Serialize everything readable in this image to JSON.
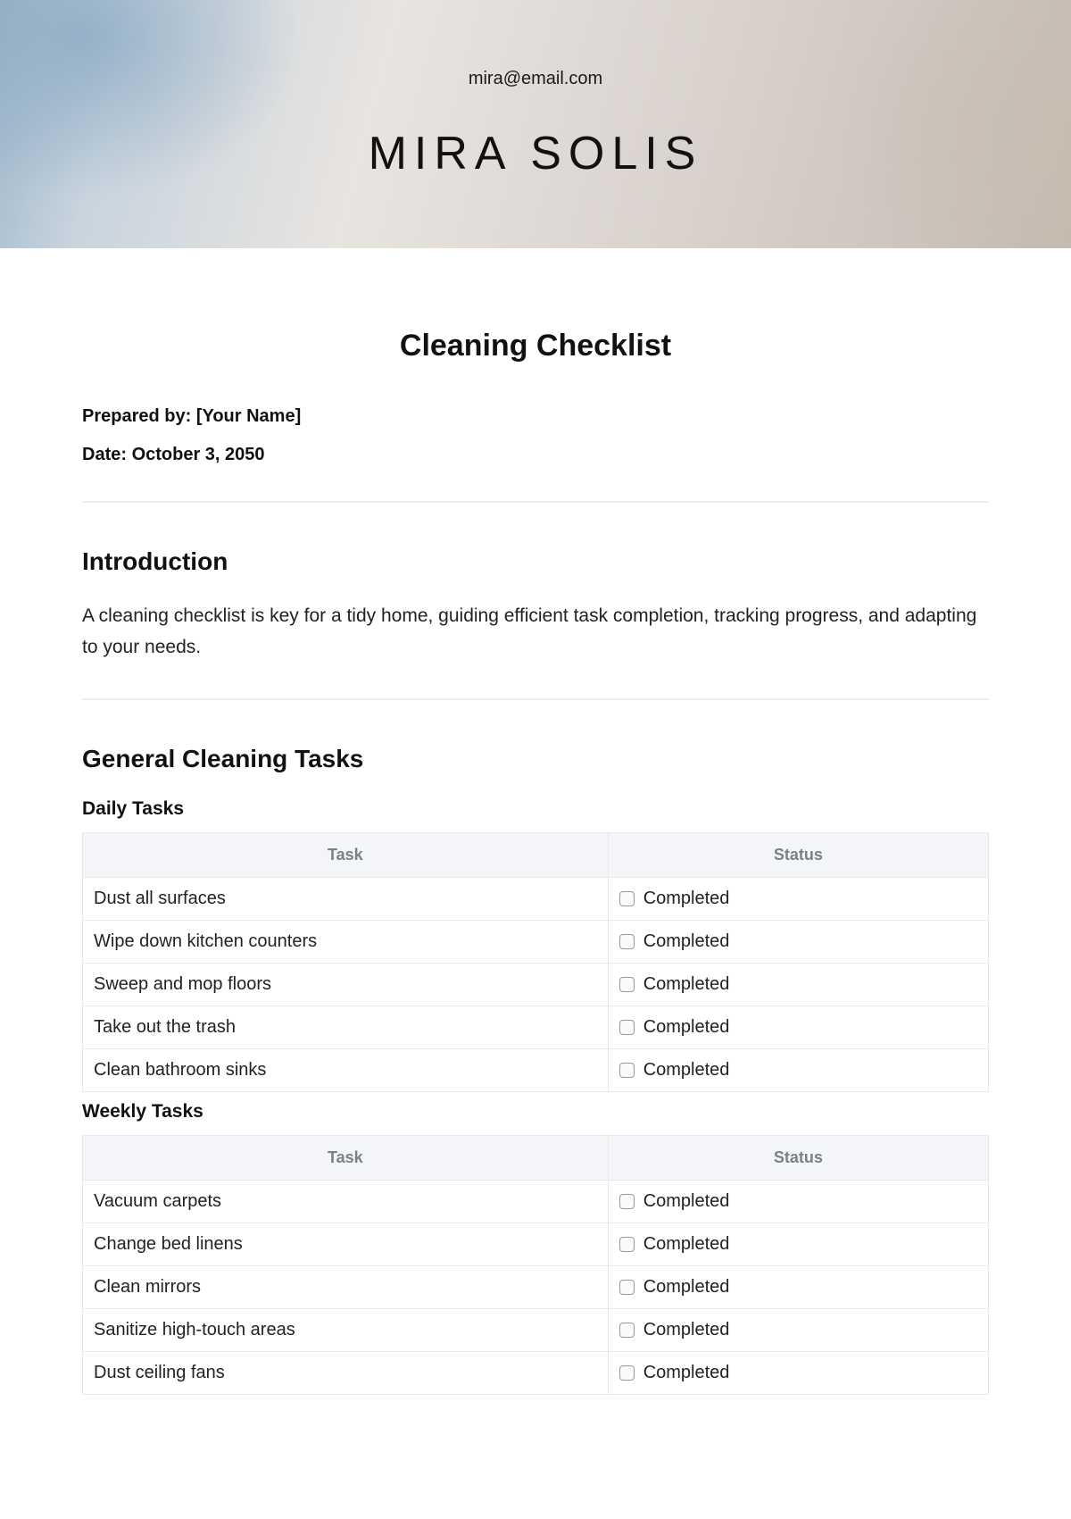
{
  "header": {
    "email": "mira@email.com",
    "name": "MIRA SOLIS"
  },
  "document": {
    "title": "Cleaning Checklist",
    "prepared_by_label": "Prepared by: [Your Name]",
    "date_label": "Date: October 3, 2050"
  },
  "introduction": {
    "heading": "Introduction",
    "body": "A cleaning checklist is key for a tidy home, guiding efficient task completion, tracking progress, and adapting to your needs."
  },
  "general": {
    "heading": "General Cleaning Tasks",
    "daily_heading": "Daily Tasks",
    "weekly_heading": "Weekly Tasks",
    "columns": {
      "task": "Task",
      "status": "Status"
    },
    "status_label": "Completed",
    "daily_tasks": [
      "Dust all surfaces",
      "Wipe down kitchen counters",
      "Sweep and mop floors",
      "Take out the trash",
      "Clean bathroom sinks"
    ],
    "weekly_tasks": [
      "Vacuum carpets",
      "Change bed linens",
      "Clean mirrors",
      "Sanitize high-touch areas",
      "Dust ceiling fans"
    ]
  }
}
